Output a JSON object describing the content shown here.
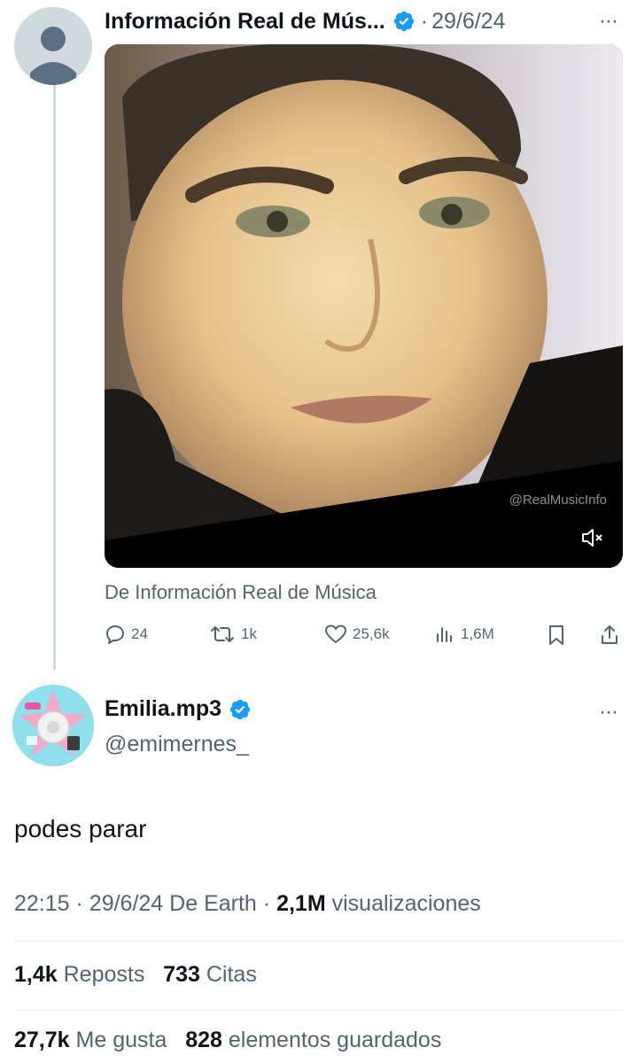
{
  "quoted_tweet": {
    "author_name": "Información Real de Mús...",
    "date": "29/6/24",
    "separator": "·",
    "more_icon": "more-horizontal-icon",
    "watermark": "@RealMusicInfo",
    "source_label": "De Información Real de Música",
    "actions": {
      "replies": "24",
      "reposts": "1k",
      "likes": "25,6k",
      "views": "1,6M"
    }
  },
  "reply_tweet": {
    "author_name": "Emilia.mp3",
    "handle": "@emimernes_",
    "text": "podes parar",
    "time": "22:15",
    "date": "29/6/24",
    "source": "De Earth",
    "views_count": "2,1M",
    "views_label": "visualizaciones",
    "reposts_count": "1,4k",
    "reposts_label": "Reposts",
    "quotes_count": "733",
    "quotes_label": "Citas",
    "likes_count": "27,7k",
    "likes_label": "Me gusta",
    "bookmarks_count": "828",
    "bookmarks_label": "elementos guardados"
  },
  "colors": {
    "verified": "#1d9bf0",
    "secondary_text": "#536471",
    "primary_text": "#0f1419",
    "divider": "#e6ecf0"
  }
}
